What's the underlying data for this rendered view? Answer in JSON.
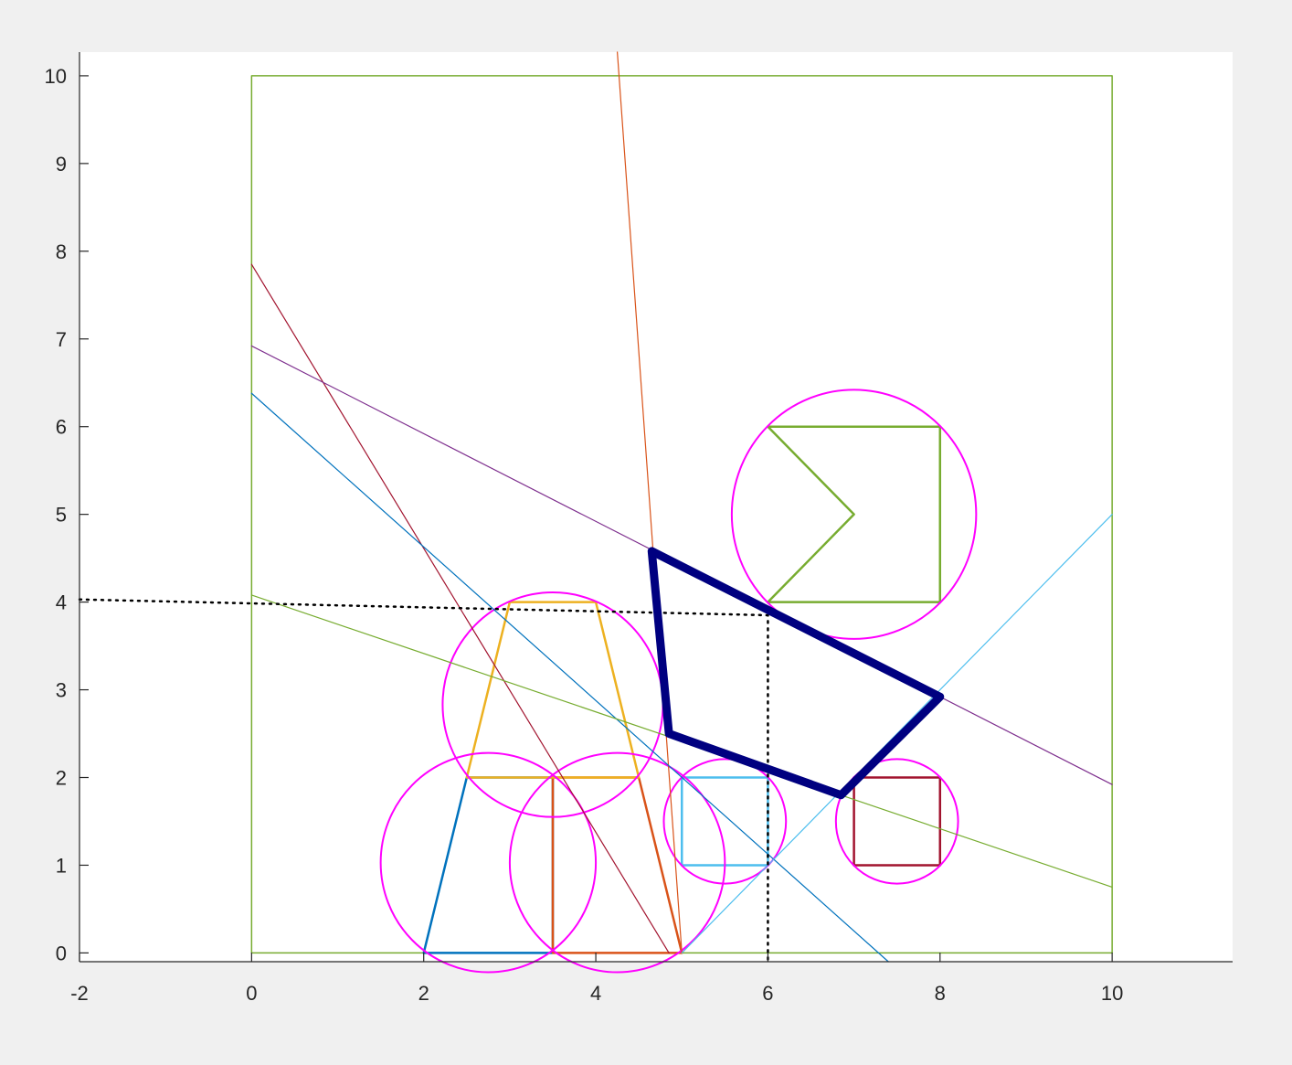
{
  "chart_data": {
    "type": "line",
    "title": "",
    "xlabel": "",
    "ylabel": "",
    "xlim": [
      -2,
      11.4
    ],
    "ylim": [
      -0.1,
      10.27
    ],
    "x_ticks": [
      -2,
      0,
      2,
      4,
      6,
      8,
      10
    ],
    "y_ticks": [
      0,
      1,
      2,
      3,
      4,
      5,
      6,
      7,
      8,
      9,
      10
    ],
    "grid": false,
    "legend": "none",
    "axes_color": "#262626",
    "background": "#ffffff",
    "figure_background": "#f0f0f0",
    "series": [
      {
        "kind": "polyline",
        "color": "#77ac30",
        "width": 1.5,
        "points": [
          [
            0,
            0
          ],
          [
            10,
            0
          ],
          [
            10,
            10
          ],
          [
            0,
            10
          ],
          [
            0,
            0
          ]
        ]
      },
      {
        "kind": "polyline",
        "color": "#0072bd",
        "width": 2.5,
        "points": [
          [
            2,
            0
          ],
          [
            2.5,
            2
          ],
          [
            3.5,
            2
          ],
          [
            3.5,
            0
          ],
          [
            2,
            0
          ]
        ]
      },
      {
        "kind": "polyline",
        "color": "#d95319",
        "width": 2.5,
        "points": [
          [
            3.5,
            0
          ],
          [
            3.5,
            2
          ],
          [
            4.5,
            2
          ],
          [
            5,
            0
          ],
          [
            3.5,
            0
          ]
        ]
      },
      {
        "kind": "polyline",
        "color": "#edb120",
        "width": 2.5,
        "points": [
          [
            2.5,
            2
          ],
          [
            3,
            4
          ],
          [
            4,
            4
          ],
          [
            4.5,
            2
          ],
          [
            2.5,
            2
          ]
        ]
      },
      {
        "kind": "polyline",
        "color": "#4dbeee",
        "width": 2.5,
        "points": [
          [
            5,
            1
          ],
          [
            5,
            2
          ],
          [
            6,
            2
          ],
          [
            6,
            1
          ],
          [
            5,
            1
          ]
        ]
      },
      {
        "kind": "polyline",
        "color": "#a2142f",
        "width": 2.5,
        "points": [
          [
            7,
            1
          ],
          [
            7,
            2
          ],
          [
            8,
            2
          ],
          [
            8,
            1
          ],
          [
            7,
            1
          ]
        ]
      },
      {
        "kind": "polyline",
        "color": "#77ac30",
        "width": 2.5,
        "points": [
          [
            6,
            4
          ],
          [
            8,
            4
          ],
          [
            8,
            6
          ],
          [
            6,
            6
          ],
          [
            7,
            5
          ],
          [
            6,
            4
          ]
        ]
      },
      {
        "kind": "circle",
        "color": "#ff00ff",
        "width": 2,
        "center": [
          2.75,
          1.03
        ],
        "radius": 1.25
      },
      {
        "kind": "circle",
        "color": "#ff00ff",
        "width": 2,
        "center": [
          4.25,
          1.03
        ],
        "radius": 1.25
      },
      {
        "kind": "circle",
        "color": "#ff00ff",
        "width": 2,
        "center": [
          3.5,
          2.83
        ],
        "radius": 1.28
      },
      {
        "kind": "circle",
        "color": "#ff00ff",
        "width": 2,
        "center": [
          5.5,
          1.5
        ],
        "radius": 0.71
      },
      {
        "kind": "circle",
        "color": "#ff00ff",
        "width": 2,
        "center": [
          7.5,
          1.5
        ],
        "radius": 0.71
      },
      {
        "kind": "circle",
        "color": "#ff00ff",
        "width": 2,
        "center": [
          7,
          5
        ],
        "radius": 1.42
      },
      {
        "kind": "polyline",
        "color": "#d95319",
        "width": 1.2,
        "points": [
          [
            4.25,
            10.27
          ],
          [
            5,
            0
          ]
        ]
      },
      {
        "kind": "polyline",
        "color": "#a2142f",
        "width": 1.2,
        "points": [
          [
            0,
            7.85
          ],
          [
            4.85,
            0
          ]
        ]
      },
      {
        "kind": "polyline",
        "color": "#7e2f8e",
        "width": 1.2,
        "points": [
          [
            0,
            6.92
          ],
          [
            10,
            1.92
          ]
        ]
      },
      {
        "kind": "polyline",
        "color": "#0072bd",
        "width": 1.2,
        "points": [
          [
            0,
            6.38
          ],
          [
            7.4,
            -0.1
          ]
        ]
      },
      {
        "kind": "polyline",
        "color": "#77ac30",
        "width": 1.2,
        "points": [
          [
            0,
            4.08
          ],
          [
            10,
            0.75
          ]
        ]
      },
      {
        "kind": "polyline",
        "color": "#4dbeee",
        "width": 1.2,
        "points": [
          [
            5,
            0
          ],
          [
            10,
            5
          ]
        ]
      },
      {
        "kind": "polyline",
        "color": "#000000",
        "width": 2.5,
        "dash": "dot",
        "points": [
          [
            -2,
            4.03
          ],
          [
            6,
            3.85
          ],
          [
            6,
            -0.1
          ]
        ]
      },
      {
        "kind": "polyline",
        "color": "#000080",
        "width": 9,
        "points": [
          [
            4.65,
            4.58
          ],
          [
            4.85,
            2.5
          ],
          [
            6.85,
            1.8
          ],
          [
            8,
            2.92
          ],
          [
            4.65,
            4.58
          ]
        ]
      }
    ]
  }
}
